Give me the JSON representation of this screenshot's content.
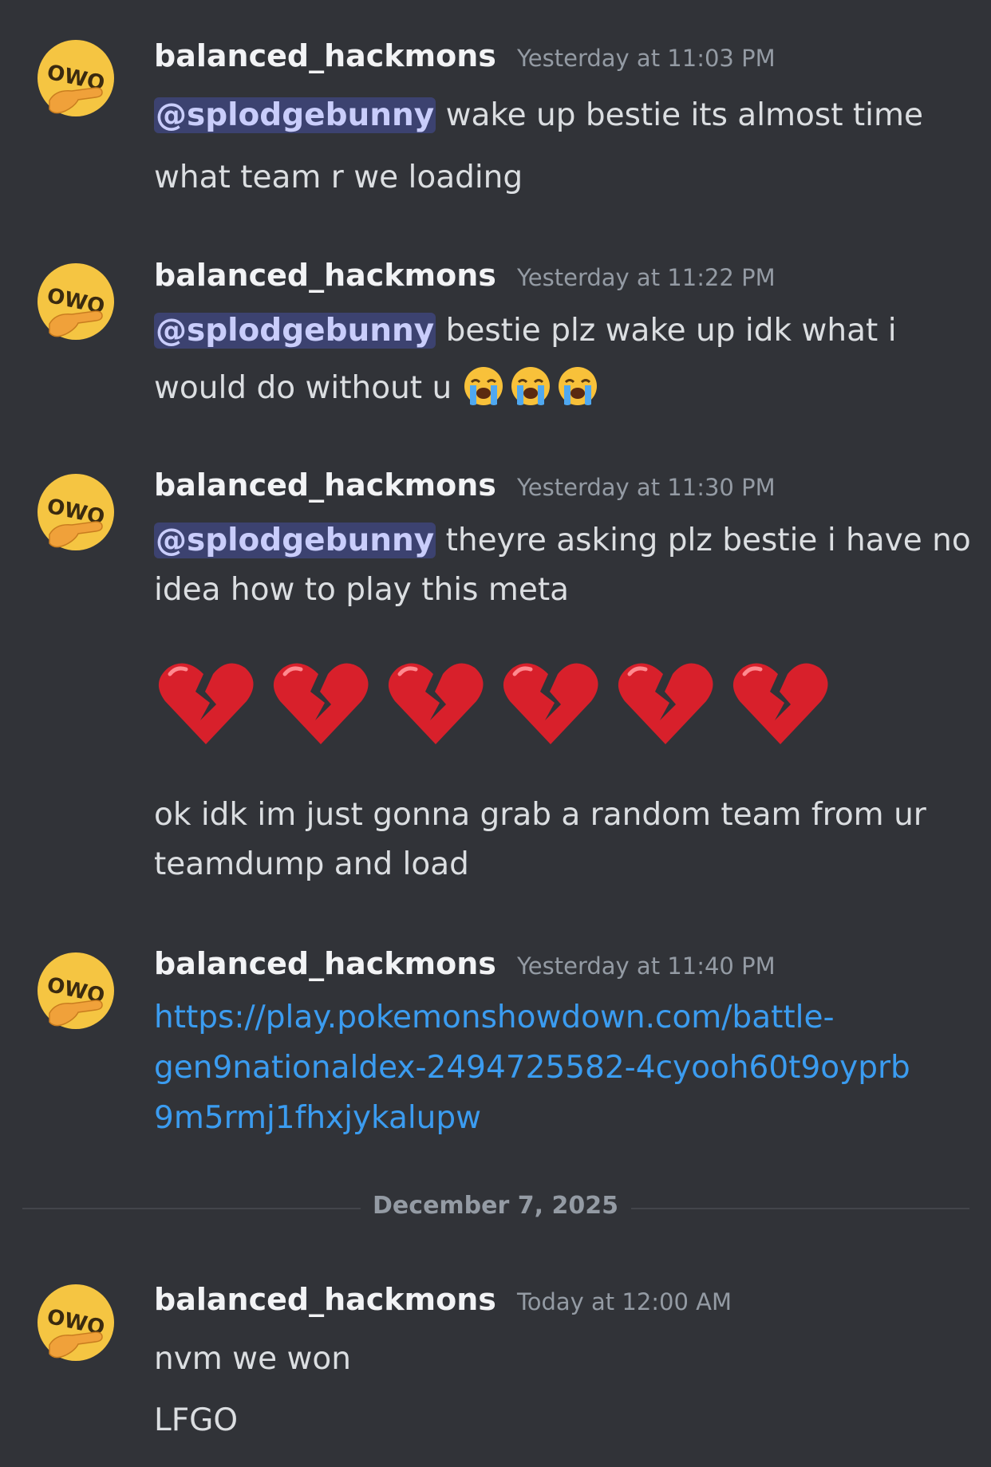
{
  "messages": [
    {
      "username": "balanced_hackmons",
      "timestamp": "Yesterday at 11:03 PM",
      "mention": "@splodgebunny",
      "line1": " wake up bestie its almost time",
      "line2": "what team r we loading"
    },
    {
      "username": "balanced_hackmons",
      "timestamp": "Yesterday at 11:22 PM",
      "mention": "@splodgebunny",
      "line1": " bestie plz wake up idk what i",
      "line2": "would do without u ",
      "emoji": "loudly-crying-face",
      "emoji_count": 3
    },
    {
      "username": "balanced_hackmons",
      "timestamp": "Yesterday at 11:30 PM",
      "mention": "@splodgebunny",
      "line1": " theyre asking plz bestie i have no",
      "line2": "idea how to play this meta",
      "big_emoji": "broken-heart",
      "big_emoji_count": 6,
      "line3": "ok idk im just gonna grab a random team from ur",
      "line4": "teamdump and load"
    },
    {
      "username": "balanced_hackmons",
      "timestamp": "Yesterday at 11:40 PM",
      "link_line1": "https://play.pokemonshowdown.com/battle-",
      "link_line2": "gen9nationaldex-2494725582-4cyooh60t9oyprb",
      "link_line3": "9m5rmj1fhxjykalupw"
    },
    {
      "username": "balanced_hackmons",
      "timestamp": "Today at 12:00 AM",
      "line1": "nvm we won",
      "line2": "LFGO"
    }
  ],
  "date_divider": "December 7, 2025",
  "avatar": {
    "icon": "owo-pointing-emoji",
    "text": "OWO",
    "face_color": "#f5c542",
    "hand_color": "#f0a13a"
  },
  "colors": {
    "background": "#313338",
    "mention_bg": "#3c4270",
    "mention_text": "#c9cdfb",
    "link": "#3b9cf0"
  }
}
